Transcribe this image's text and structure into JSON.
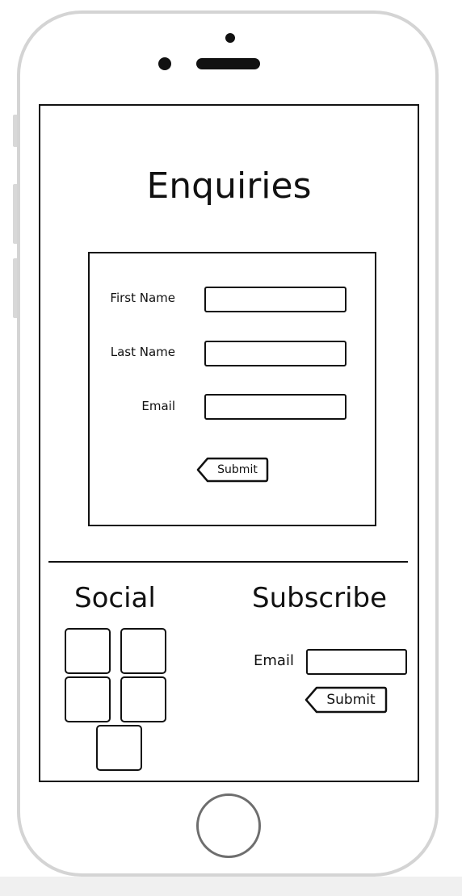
{
  "page": {
    "title": "Enquiries"
  },
  "form": {
    "fields": [
      {
        "label": "First Name",
        "value": ""
      },
      {
        "label": "Last Name",
        "value": ""
      },
      {
        "label": "Email",
        "value": ""
      }
    ],
    "submit_label": "Submit"
  },
  "social": {
    "title": "Social",
    "tiles": [
      "social-tile",
      "social-tile",
      "social-tile",
      "social-tile",
      "social-tile"
    ]
  },
  "subscribe": {
    "title": "Subscribe",
    "email_label": "Email",
    "email_value": "",
    "submit_label": "Submit"
  },
  "colors": {
    "ink": "#111111",
    "phone_frame": "#d4d4d4",
    "home_ring": "#6e6e6e",
    "background": "#ffffff"
  }
}
